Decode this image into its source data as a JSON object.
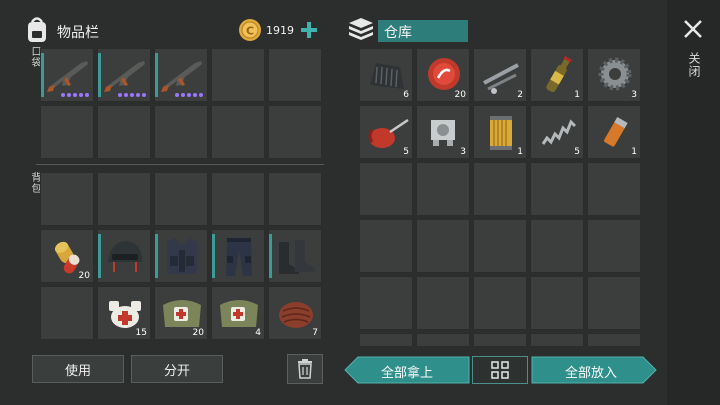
{
  "header": {
    "inventory_title": "物品栏",
    "coins": "1919",
    "warehouse_title": "仓库"
  },
  "labels": {
    "pocket": "口袋",
    "backpack": "背包",
    "close": "关闭"
  },
  "pocket_items": [
    {
      "icon": "rifle-icon",
      "qty": ""
    },
    {
      "icon": "rifle-icon",
      "qty": ""
    },
    {
      "icon": "rifle-icon",
      "qty": ""
    }
  ],
  "backpack_items": [
    {
      "icon": "pill-capsules-icon",
      "qty": "20"
    },
    {
      "icon": "helmet-icon",
      "qty": ""
    },
    {
      "icon": "vest-icon",
      "qty": ""
    },
    {
      "icon": "pants-icon",
      "qty": ""
    },
    {
      "icon": "boots-icon",
      "qty": ""
    },
    {
      "icon": "bandage-icon",
      "qty": "15"
    },
    {
      "icon": "medkit-icon",
      "qty": "20"
    },
    {
      "icon": "medkit-icon",
      "qty": "4"
    },
    {
      "icon": "meat-icon",
      "qty": "7"
    }
  ],
  "warehouse_items": [
    {
      "icon": "scrap-metal-icon",
      "qty": "6"
    },
    {
      "icon": "bottle-cap-icon",
      "qty": "20"
    },
    {
      "icon": "pipes-icon",
      "qty": "2"
    },
    {
      "icon": "beer-bottle-icon",
      "qty": "1"
    },
    {
      "icon": "gear-icon",
      "qty": "3"
    },
    {
      "icon": "oil-can-icon",
      "qty": "5"
    },
    {
      "icon": "engine-part-icon",
      "qty": "3"
    },
    {
      "icon": "filter-icon",
      "qty": "1"
    },
    {
      "icon": "spring-icon",
      "qty": "5"
    },
    {
      "icon": "lighter-icon",
      "qty": "1"
    }
  ],
  "buttons": {
    "use": "使用",
    "split": "分开",
    "take_all": "全部拿上",
    "put_all": "全部放入"
  },
  "colors": {
    "accent": "#2f8f8b",
    "rarity": "#9a77ff",
    "coin": "#e0a93a"
  }
}
